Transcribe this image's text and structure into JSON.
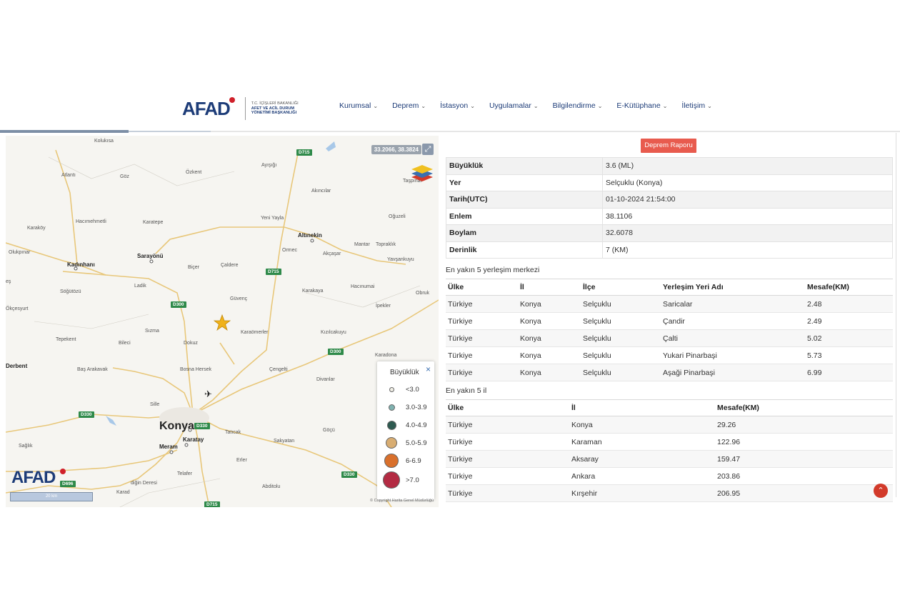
{
  "header": {
    "logo_text": "AFAD",
    "logo_sub_small": "T.C. İÇİŞLERİ BAKANLIĞI",
    "logo_sub": "AFET VE ACİL DURUM YÖNETİMİ BAŞKANLIĞI",
    "nav": [
      {
        "label": "Kurumsal"
      },
      {
        "label": "Deprem"
      },
      {
        "label": "İstasyon"
      },
      {
        "label": "Uygulamalar"
      },
      {
        "label": "Bilgilendirme"
      },
      {
        "label": "E-Kütüphane"
      },
      {
        "label": "İletişim"
      }
    ]
  },
  "map": {
    "coords": "33.2066, 38.3824",
    "logo": "AFAD",
    "scale": "20 km",
    "copyright": "© Copyright Harita Genel Müdürlüğü",
    "places": {
      "kolukisa": "Kolukısa",
      "atlanti": "Atlantı",
      "goz": "Göz",
      "ozkent": "Özkent",
      "aysigi": "Ayışığı",
      "tasp": "Taşpınar",
      "akincilar": "Akıncılar",
      "oguzeli": "Oğuzeli",
      "karakoy": "Karaköy",
      "hacimehmetli": "Hacımehmetli",
      "karatepe": "Karatepe",
      "yeniyayla": "Yeni Yayla",
      "altinekin": "Altınekin",
      "olukpinar": "Olukpınar",
      "sarayonu": "Sarayönü",
      "mantar": "Mantar",
      "topraklik": "Topraklık",
      "kadinhani": "Kadınhanı",
      "bicer": "Biçer",
      "caldere": "Çaldere",
      "ormec": "Ormec",
      "akcasar": "Akçaşar",
      "yavsankuyu": "Yavşankuyu",
      "ladik": "Ladik",
      "sogutozu": "Söğütözü",
      "guvenc": "Güvenç",
      "karakaya": "Karakaya",
      "hacinumai": "Hacınumai",
      "obruk": "Obruk",
      "okcesyurt": "Ökçesyurt",
      "ipekler": "İpekler",
      "tepekent": "Tepekent",
      "sizma": "Sızma",
      "bilecik": "Bileci",
      "karaomerler": "Karaömerler",
      "kizilcakuyu": "Kızılcakuyu",
      "dokuz": "Dokuz",
      "karadona": "Karadona",
      "derbent": "Derbent",
      "basarakavak": "Baş Arakavak",
      "bosnahersek": "Bosna Hersek",
      "cengelti": "Çengelti",
      "divanlar": "Divanlar",
      "sille": "Sille",
      "konya": "Konya",
      "karatay": "Karatay",
      "meram": "Meram",
      "taticak": "Tatıcak",
      "sakyatan": "Sakyatan",
      "gocu": "Göçü",
      "saglik": "Sağlık",
      "erler": "Erler",
      "telafer": "Telafer",
      "digin": "diğin Deresi",
      "karad": "Karad",
      "abditolu": "Abditolu",
      "hatipler": "Hatiplerip",
      "ilyas": "İlyas",
      "es": "eş"
    },
    "roads": {
      "d715a": "D715",
      "d715b": "D715",
      "d300a": "D300",
      "d300b": "D300",
      "d330a": "D330",
      "d330b": "D330",
      "d330c": "D330",
      "d696": "D696",
      "d715c": "D715"
    },
    "legend": {
      "title": "Büyüklük",
      "close": "×",
      "items": [
        {
          "label": "<3.0",
          "color": "#f1efe6"
        },
        {
          "label": "3.0-3.9",
          "color": "#7fb2b0"
        },
        {
          "label": "4.0-4.9",
          "color": "#2e5a50"
        },
        {
          "label": "5.0-5.9",
          "color": "#d8ad72"
        },
        {
          "label": "6-6.9",
          "color": "#d9702c"
        },
        {
          "label": ">7.0",
          "color": "#b32b43"
        }
      ]
    },
    "epicenter_color": "#f0b21a"
  },
  "report_button": "Deprem Raporu",
  "details": [
    {
      "key": "Büyüklük",
      "value": "3.6 (ML)"
    },
    {
      "key": "Yer",
      "value": "Selçuklu (Konya)"
    },
    {
      "key": "Tarih(UTC)",
      "value": "01-10-2024 21:54:00"
    },
    {
      "key": "Enlem",
      "value": "38.1106"
    },
    {
      "key": "Boylam",
      "value": "32.6078"
    },
    {
      "key": "Derinlik",
      "value": "7 (KM)"
    }
  ],
  "settlements": {
    "title": "En yakın 5 yerleşim merkezi",
    "headers": [
      "Ülke",
      "İl",
      "İlçe",
      "Yerleşim Yeri Adı",
      "Mesafe(KM)"
    ],
    "rows": [
      [
        "Türkiye",
        "Konya",
        "Selçuklu",
        "Saricalar",
        "2.48"
      ],
      [
        "Türkiye",
        "Konya",
        "Selçuklu",
        "Çandir",
        "2.49"
      ],
      [
        "Türkiye",
        "Konya",
        "Selçuklu",
        "Çalti",
        "5.02"
      ],
      [
        "Türkiye",
        "Konya",
        "Selçuklu",
        "Yukari Pinarbaşi",
        "5.73"
      ],
      [
        "Türkiye",
        "Konya",
        "Selçuklu",
        "Aşaği Pinarbaşi",
        "6.99"
      ]
    ]
  },
  "provinces": {
    "title": "En yakın 5 il",
    "headers": [
      "Ülke",
      "İl",
      "Mesafe(KM)"
    ],
    "rows": [
      [
        "Türkiye",
        "Konya",
        "29.26"
      ],
      [
        "Türkiye",
        "Karaman",
        "122.96"
      ],
      [
        "Türkiye",
        "Aksaray",
        "159.47"
      ],
      [
        "Türkiye",
        "Ankara",
        "203.86"
      ],
      [
        "Türkiye",
        "Kırşehir",
        "206.95"
      ]
    ]
  }
}
